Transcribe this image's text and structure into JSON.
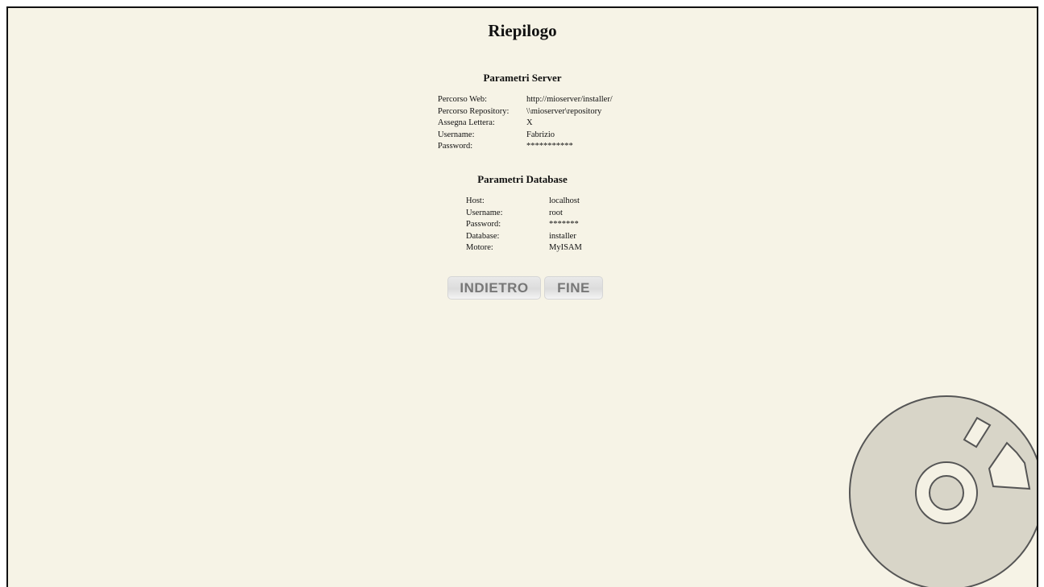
{
  "title": "Riepilogo",
  "server": {
    "heading": "Parametri Server",
    "rows": [
      {
        "label": "Percorso Web:",
        "value": "http://mioserver/installer/"
      },
      {
        "label": "Percorso Repository:",
        "value": "\\\\mioserver\\repository"
      },
      {
        "label": "Assegna Lettera:",
        "value": "X"
      },
      {
        "label": "Username:",
        "value": "Fabrizio"
      },
      {
        "label": "Password:",
        "value": "***********"
      }
    ]
  },
  "database": {
    "heading": "Parametri Database",
    "rows": [
      {
        "label": "Host:",
        "value": "localhost"
      },
      {
        "label": "Username:",
        "value": "root"
      },
      {
        "label": "Password:",
        "value": "*******"
      },
      {
        "label": "Database:",
        "value": "installer"
      },
      {
        "label": "Motore:",
        "value": "MyISAM"
      }
    ]
  },
  "buttons": {
    "back_label": "INDIETRO",
    "finish_label": "FINE"
  },
  "icons": {
    "watermark": "cd-disc-icon"
  },
  "colors": {
    "background": "#f6f3e6",
    "disc_fill": "#d8d5c8",
    "disc_stroke": "#555555"
  }
}
